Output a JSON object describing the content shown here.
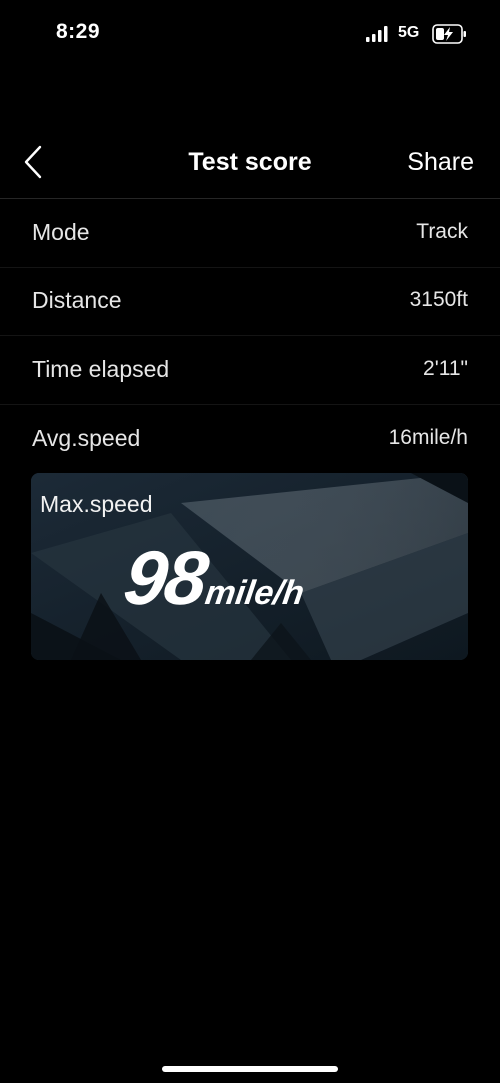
{
  "status_bar": {
    "time": "8:29",
    "network": "5G",
    "signal_icon": "cellular-signal-icon",
    "battery_icon": "battery-charging-icon"
  },
  "nav": {
    "back_icon": "chevron-left-icon",
    "title": "Test score",
    "share_label": "Share"
  },
  "stats": [
    {
      "label": "Mode",
      "value": "Track"
    },
    {
      "label": "Distance",
      "value": "3150ft"
    },
    {
      "label": "Time elapsed",
      "value": "2'11\""
    },
    {
      "label": "Avg.speed",
      "value": "16mile/h"
    }
  ],
  "max_speed": {
    "label": "Max.speed",
    "value": "98",
    "unit": "mile/h"
  },
  "colors": {
    "background": "#000000",
    "card_background": "#16222e",
    "text": "#ffffff"
  }
}
